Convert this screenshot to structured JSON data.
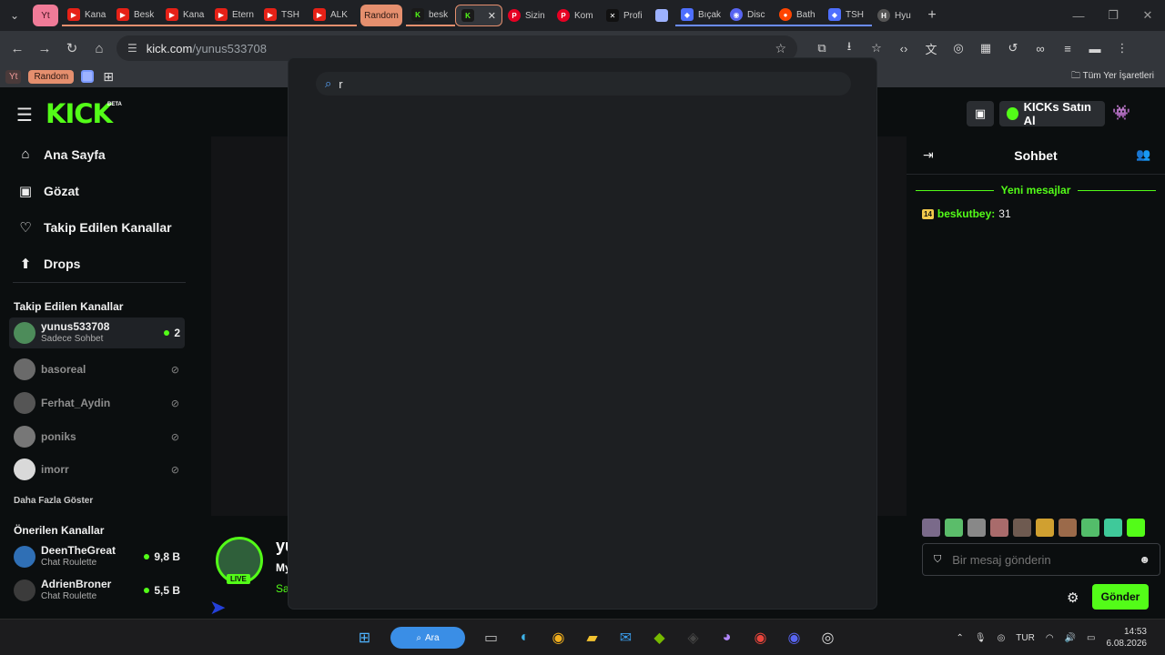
{
  "browser": {
    "tabs": [
      {
        "label": "Kana",
        "icon": "youtube"
      },
      {
        "label": "Besk",
        "icon": "youtube"
      },
      {
        "label": "Kana",
        "icon": "youtube"
      },
      {
        "label": "Etern",
        "icon": "youtube"
      },
      {
        "label": "TSH",
        "icon": "youtube"
      },
      {
        "label": "ALK",
        "icon": "youtube"
      },
      {
        "label": "besk",
        "icon": "kick"
      },
      {
        "label": "Sizin",
        "icon": "pinterest"
      },
      {
        "label": "Kom",
        "icon": "pinterest"
      },
      {
        "label": "Profi",
        "icon": "x"
      },
      {
        "label": "Bıçak",
        "icon": "bookmark"
      },
      {
        "label": "Disc",
        "icon": "discord"
      },
      {
        "label": "Bath",
        "icon": "reddit"
      },
      {
        "label": "TSH",
        "icon": "bookmark"
      },
      {
        "label": "Hyu",
        "icon": "hyu"
      }
    ],
    "group_yt": "Yt",
    "group_random": "Random",
    "url_host": "kick.com",
    "url_path": "/yunus533708",
    "bookmarks": {
      "yt": "Yt",
      "random": "Random",
      "all_bookmarks": "Tüm Yer İşaretleri"
    }
  },
  "kick": {
    "logo": "KICK",
    "beta": "BETA",
    "buy_button": "KICKs Satın Al",
    "nav": [
      {
        "label": "Ana Sayfa",
        "icon": "home-icon"
      },
      {
        "label": "Gözat",
        "icon": "browse-icon"
      },
      {
        "label": "Takip Edilen Kanallar",
        "icon": "heart-icon"
      },
      {
        "label": "Drops",
        "icon": "drops-icon"
      }
    ],
    "followed_title": "Takip Edilen Kanallar",
    "followed": [
      {
        "name": "yunus533708",
        "sub": "Sadece Sohbet",
        "viewers": "2"
      },
      {
        "name": "basoreal"
      },
      {
        "name": "Ferhat_Aydin"
      },
      {
        "name": "poniks"
      },
      {
        "name": "imorr"
      }
    ],
    "show_more": "Daha Fazla Göster",
    "suggested_title": "Önerilen Kanallar",
    "suggested": [
      {
        "name": "DeenTheGreat",
        "sub": "Chat Roulette",
        "viewers": "9,8 B"
      },
      {
        "name": "AdrienBroner",
        "sub": "Chat Roulette",
        "viewers": "5,5 B"
      }
    ],
    "stream": {
      "name": "yu",
      "subtitle": "My",
      "category": "Sa",
      "live": "LIVE"
    },
    "chat": {
      "title": "Sohbet",
      "new_messages": "Yeni mesajlar",
      "messages": [
        {
          "badge": "14",
          "user": "beskutbey:",
          "text": "31"
        }
      ],
      "placeholder": "Bir mesaj gönderin",
      "send": "Gönder"
    },
    "search": {
      "value": "r"
    }
  },
  "taskbar": {
    "search_label": "Ara",
    "lang": "TUR",
    "time": "14:53",
    "date": "6.08.2026"
  },
  "colors": {
    "accent": "#53fc18",
    "random_chip": "#e58f6e"
  }
}
